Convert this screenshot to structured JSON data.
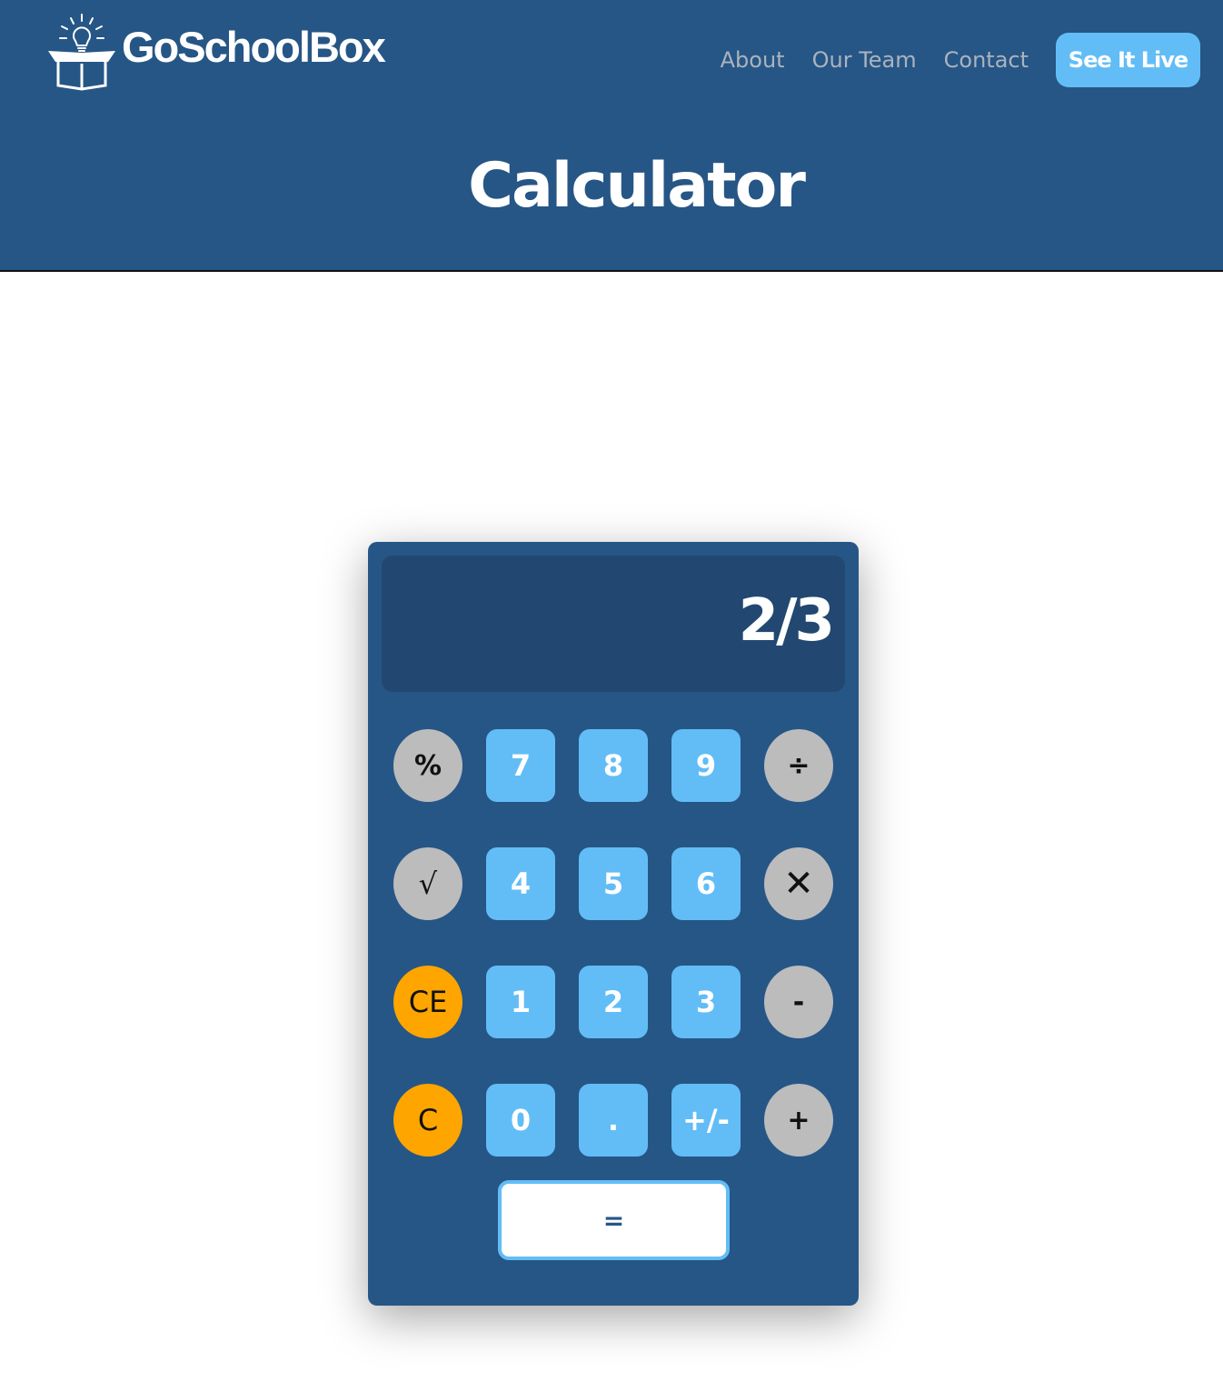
{
  "header": {
    "brand": "GoSchoolBox",
    "logo_icon": "lightbulb-box-icon",
    "nav": [
      {
        "label": "About"
      },
      {
        "label": "Our Team"
      },
      {
        "label": "Contact"
      }
    ],
    "cta_label": "See It Live",
    "page_title": "Calculator"
  },
  "calculator": {
    "display": "2/3",
    "keys": {
      "percent": "%",
      "sqrt": "√",
      "ce": "CE",
      "c": "C",
      "seven": "7",
      "eight": "8",
      "nine": "9",
      "divide": "÷",
      "four": "4",
      "five": "5",
      "six": "6",
      "multiply": "✕",
      "one": "1",
      "two": "2",
      "three": "3",
      "minus": "-",
      "zero": "0",
      "decimal": ".",
      "sign": "+/-",
      "plus": "+",
      "equals": "="
    }
  },
  "colors": {
    "header_bg": "#265686",
    "calc_bg": "#265686",
    "display_bg": "#224871",
    "number_key": "#62bdf6",
    "function_key": "#bcbcbc",
    "clear_key": "#ffa500",
    "cta_bg": "#62bdf6"
  }
}
